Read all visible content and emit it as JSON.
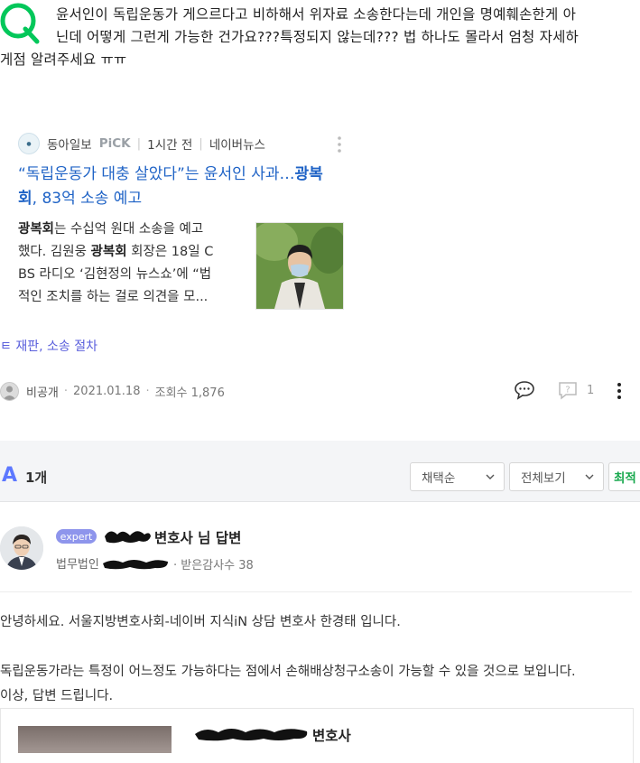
{
  "question": {
    "mark": "Q",
    "line1": "윤서인이 독립운동가 게으르다고 비하해서 위자료 소송한다는데 개인을 명예훼손한게 아",
    "line2": "닌데 어떻게 그런게 가능한 건가요???특정되지 않는데??? 법 하나도 몰라서 엄청 자세하",
    "line3": "게점 알려주세요 ㅠㅠ"
  },
  "news": {
    "source": "동아일보",
    "pick": "PiCK",
    "time": "1시간 전",
    "platform": "네이버뉴스",
    "title_part1": "“독립운동가 대충 살았다”는 윤서인 사과…",
    "title_highlight1": "광복",
    "title_highlight2": "회",
    "title_part2": ", 83억 소송 예고",
    "body_hl1": "광복회",
    "body_1": "는 수십억 원대 소송을 예고",
    "body_2": "했다. 김원웅 ",
    "body_hl2": "광복회",
    "body_3": " 회장은 18일 C",
    "body_4": "BS 라디오 ‘김현정의 뉴스쇼’에 “법",
    "body_5": "적인 조치를 하는 걸로 의견을 모..."
  },
  "tags": "ㅌ 재판, 소송 절차",
  "meta": {
    "author": "비공개",
    "date": "2021.01.18",
    "views": "조회수 1,876",
    "answer_count": "1"
  },
  "answers_header": {
    "icon_letter": "A",
    "count": "1개",
    "sort_select": "채택순",
    "filter_select": "전체보기",
    "best_label": "최적"
  },
  "answer": {
    "badge": "expert",
    "title_suffix": "변호사 님 답변",
    "firm_prefix": "법무법인",
    "thanks": "받은감사수 38",
    "para1": "안녕하세요. 서울지방변호사회-네이버 지식iN 상담 변호사 한경태 입니다.",
    "para2": "독립운동가라는 특정이 어느정도 가능하다는 점에서 손해배상청구소송이 가능할 수 있을 것으로 보입니다.",
    "para3": "이상, 답변 드립니다.",
    "profile_suffix": "변호사"
  },
  "colors": {
    "brand_green": "#03c75a",
    "link_blue": "#1f63c6",
    "accent_purple": "#5d78ff",
    "tag_purple": "#5a5fdc",
    "expert_badge": "#8e95ec"
  }
}
